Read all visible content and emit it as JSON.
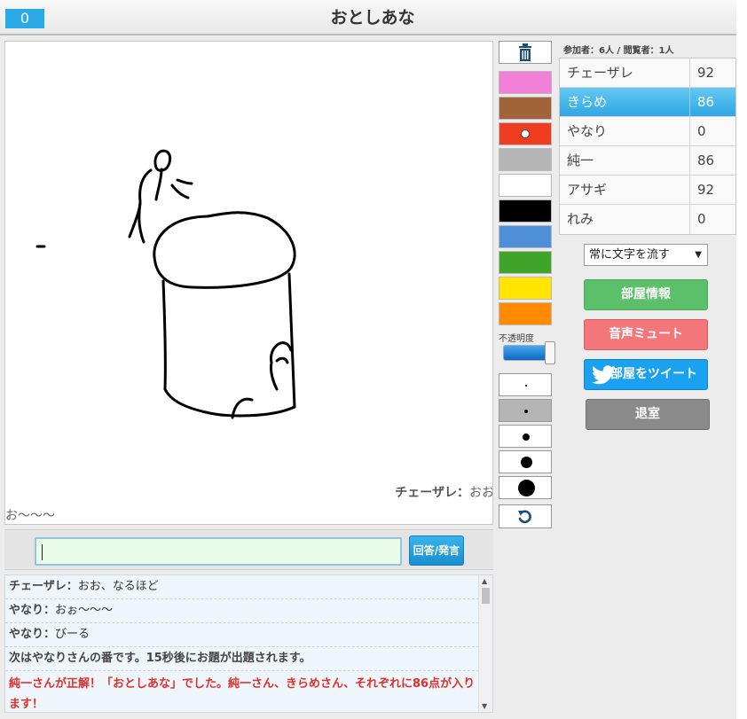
{
  "header": {
    "score": "0",
    "title": "おとしあな"
  },
  "canvas": {
    "overlay_speaker": "チェーザレ：",
    "overlay_text_1": "おお",
    "overlay_text_2": "お～～～"
  },
  "answer": {
    "input_value": "",
    "submit_label": "回答/発言"
  },
  "chat": [
    {
      "speaker": "チェーザレ：",
      "text": "おお、なるほど"
    },
    {
      "speaker": "やなり：",
      "text": "おぉ～～～"
    },
    {
      "speaker": "やなり：",
      "text": "びーる"
    }
  ],
  "chat_system": "次はやなりさんの番です。15秒後にお題が出題されます。",
  "chat_correct": "純一さんが正解！「おとしあな」でした。純一さん、きらめさん、それぞれに86点が入ります！",
  "tools": {
    "colors": [
      "#f27fd8",
      "#a0633a",
      "#f03c1e",
      "#b5b5b5",
      "#ffffff",
      "#000000",
      "#4d8fd8",
      "#3ea42a",
      "#ffe500",
      "#ff8a00"
    ],
    "selected_color_index": 2,
    "opacity_label": "不透明度",
    "opacity_value": 1.0,
    "selected_size_index": 1
  },
  "room": {
    "participants_label": "参加者：6人 / 閲覧者：1人"
  },
  "players": [
    {
      "name": "チェーザレ",
      "score": "92"
    },
    {
      "name": "きらめ",
      "score": "86"
    },
    {
      "name": "やなり",
      "score": "0"
    },
    {
      "name": "純一",
      "score": "86"
    },
    {
      "name": "アサギ",
      "score": "92"
    },
    {
      "name": "れみ",
      "score": "0"
    }
  ],
  "active_player_index": 1,
  "text_flow_select": "常に文字を流す",
  "buttons": {
    "room_info": "部屋情報",
    "mute": "音声ミュート",
    "tweet": "部屋をツイート",
    "exit": "退室"
  }
}
